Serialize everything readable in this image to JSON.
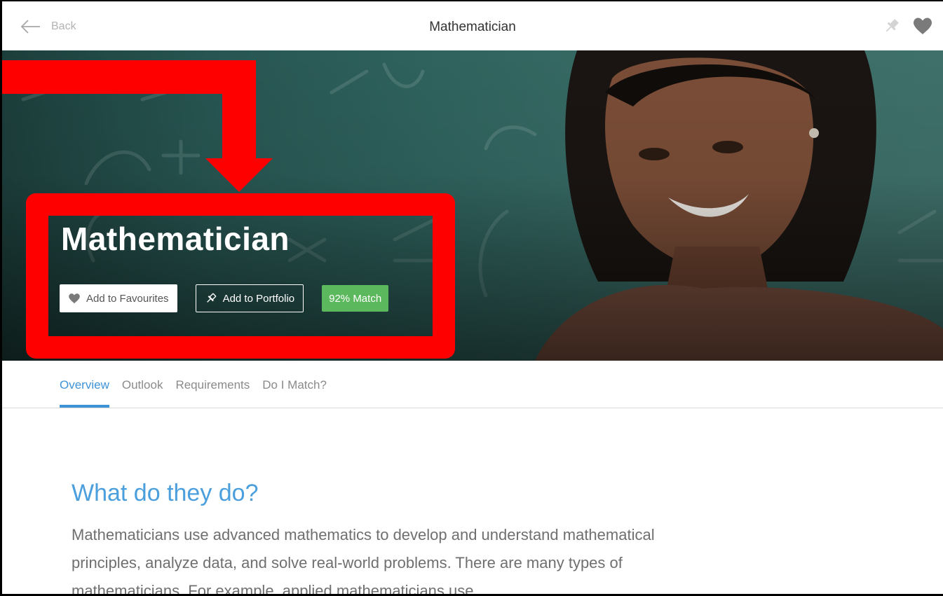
{
  "nav": {
    "back_label": "Back",
    "title": "Mathematician"
  },
  "hero": {
    "title": "Mathematician",
    "add_favourites_label": "Add to Favourites",
    "add_portfolio_label": "Add to Portfolio",
    "match_label": "92% Match",
    "match_value_percent": 92
  },
  "tabs": [
    {
      "label": "Overview",
      "active": true
    },
    {
      "label": "Outlook",
      "active": false
    },
    {
      "label": "Requirements",
      "active": false
    },
    {
      "label": "Do I Match?",
      "active": false
    }
  ],
  "content": {
    "heading": "What do they do?",
    "paragraph": "Mathematicians use advanced mathematics to develop and understand mathematical principles, analyze data, and solve real-world problems. There are many types of mathematicians. For example, applied mathematicians use"
  },
  "icons": {
    "back": "back-arrow-icon",
    "pin": "pin-icon",
    "heart": "heart-icon"
  },
  "colors": {
    "accent_blue": "#3e93d7",
    "match_green": "#5cb85c",
    "annotation_red": "#ff0000"
  }
}
